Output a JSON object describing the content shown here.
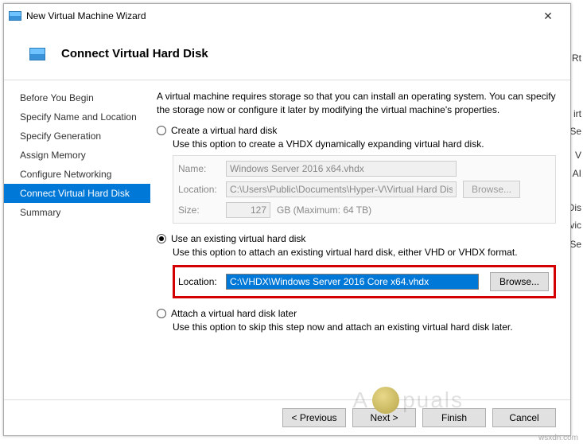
{
  "titlebar": {
    "title": "New Virtual Machine Wizard",
    "close_glyph": "✕"
  },
  "header": {
    "title": "Connect Virtual Hard Disk"
  },
  "sidebar": {
    "items": [
      {
        "label": "Before You Begin"
      },
      {
        "label": "Specify Name and Location"
      },
      {
        "label": "Specify Generation"
      },
      {
        "label": "Assign Memory"
      },
      {
        "label": "Configure Networking"
      },
      {
        "label": "Connect Virtual Hard Disk"
      },
      {
        "label": "Summary"
      }
    ],
    "active_index": 5
  },
  "intro": "A virtual machine requires storage so that you can install an operating system. You can specify the storage now or configure it later by modifying the virtual machine's properties.",
  "option_create": {
    "label": "Create a virtual hard disk",
    "desc": "Use this option to create a VHDX dynamically expanding virtual hard disk.",
    "name_label": "Name:",
    "name_value": "Windows Server 2016 x64.vhdx",
    "location_label": "Location:",
    "location_value": "C:\\Users\\Public\\Documents\\Hyper-V\\Virtual Hard Disks\\",
    "size_label": "Size:",
    "size_value": "127",
    "size_unit": "GB (Maximum: 64 TB)",
    "browse_label": "Browse..."
  },
  "option_existing": {
    "label": "Use an existing virtual hard disk",
    "desc": "Use this option to attach an existing virtual hard disk, either VHD or VHDX format.",
    "location_label": "Location:",
    "location_value": "C:\\VHDX\\Windows Server 2016 Core x64.vhdx",
    "browse_label": "Browse..."
  },
  "option_later": {
    "label": "Attach a virtual hard disk later",
    "desc": "Use this option to skip this step now and attach an existing virtual hard disk later."
  },
  "selected_option": "existing",
  "footer": {
    "previous": "< Previous",
    "next": "Next >",
    "finish": "Finish",
    "cancel": "Cancel"
  },
  "background_hints": [
    "irt",
    "Se",
    "V",
    "AI",
    "Dis",
    "vic",
    "Se",
    "Rt"
  ],
  "watermark": {
    "left": "A",
    "right": "puals"
  },
  "source": "wsxdn.com"
}
